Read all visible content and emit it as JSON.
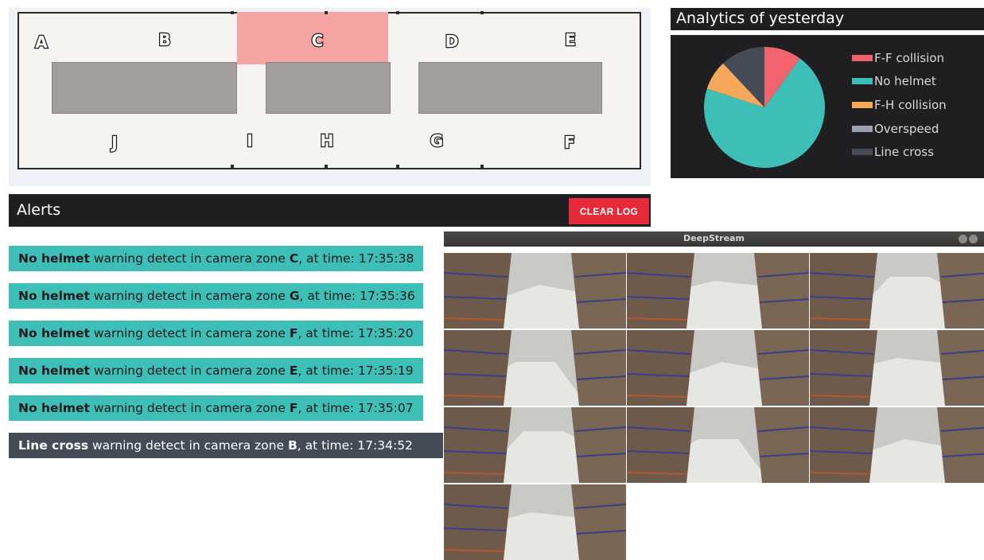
{
  "floor_map": {
    "highlighted_zone": "C",
    "highlight_color": "#f5a3a3",
    "zones_top": [
      "A",
      "B",
      "C",
      "D",
      "E"
    ],
    "zones_bottom": [
      "J",
      "I",
      "H",
      "G",
      "F"
    ]
  },
  "analytics": {
    "title": "Analytics of yesterday",
    "chart_data": {
      "type": "pie",
      "title": "Analytics of yesterday",
      "legend_placement": "right",
      "slices": [
        {
          "name": "F-F collision",
          "value": 10,
          "color": "#f2636d"
        },
        {
          "name": "No helmet",
          "value": 70,
          "color": "#3dbfb7"
        },
        {
          "name": "F-H collision",
          "value": 8,
          "color": "#f5a85a"
        },
        {
          "name": "Overspeed",
          "value": 0,
          "color": "#9aa0ad"
        },
        {
          "name": "Line cross",
          "value": 12,
          "color": "#454a57"
        }
      ]
    }
  },
  "alerts": {
    "title": "Alerts",
    "clear_label": "CLEAR LOG",
    "clear_color": "#e52b3a",
    "mid_text": " warning detect in camera zone ",
    "time_text": ", at time: ",
    "items": [
      {
        "type": "No helmet",
        "zone": "C",
        "time": "17:35:38",
        "color": "#3dbfb7"
      },
      {
        "type": "No helmet",
        "zone": "G",
        "time": "17:35:36",
        "color": "#3dbfb7"
      },
      {
        "type": "No helmet",
        "zone": "F",
        "time": "17:35:20",
        "color": "#3dbfb7"
      },
      {
        "type": "No helmet",
        "zone": "E",
        "time": "17:35:19",
        "color": "#3dbfb7"
      },
      {
        "type": "No helmet",
        "zone": "F",
        "time": "17:35:07",
        "color": "#3dbfb7"
      },
      {
        "type": "Line cross",
        "zone": "B",
        "time": "17:34:52",
        "color": "#454a57"
      }
    ]
  },
  "deepstream": {
    "window_title": "DeepStream",
    "camera_count": 10,
    "window_buttons": [
      "minimize-icon",
      "maximize-icon",
      "close-icon"
    ]
  }
}
